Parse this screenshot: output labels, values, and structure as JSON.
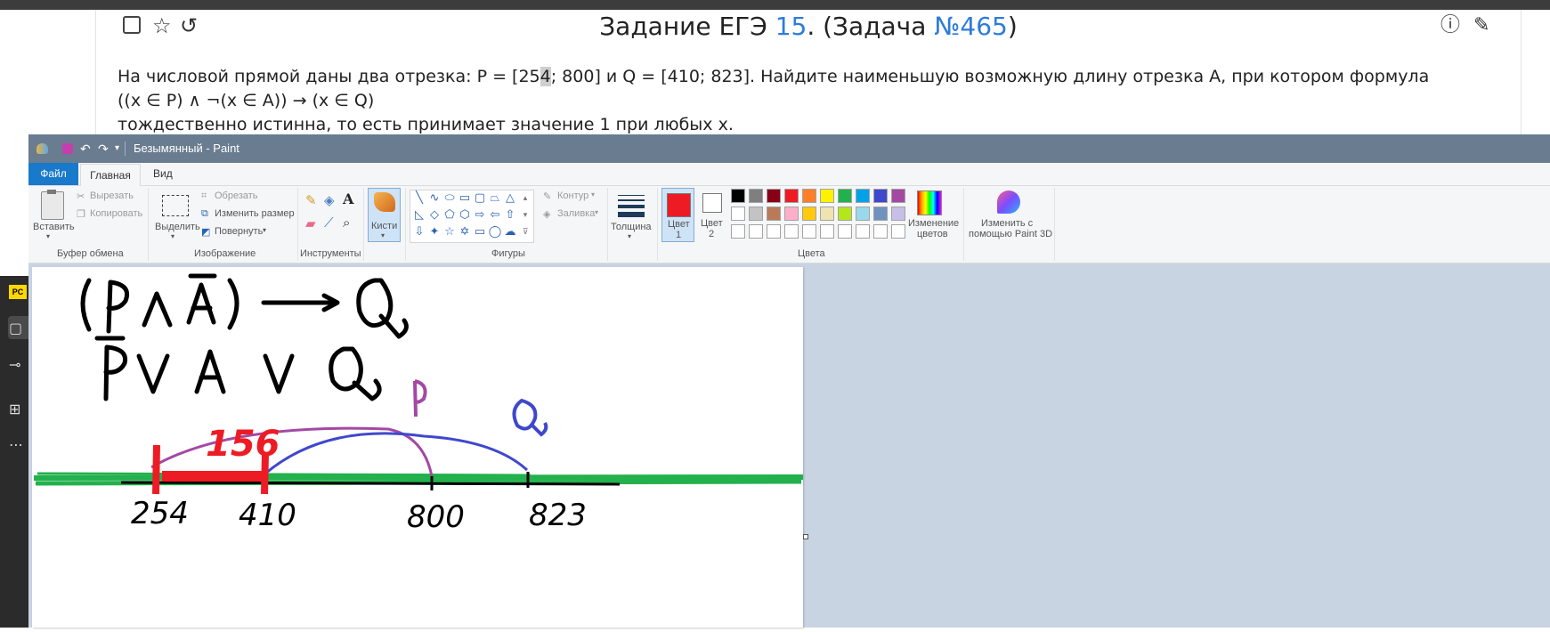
{
  "webpage": {
    "title_prefix": "Задание ЕГЭ ",
    "task_number": "15",
    "title_mid": ". (Задача ",
    "problem_number": "№465",
    "title_suffix": ")",
    "text_line1_a": "На числовой прямой даны два отрезка: P = [25",
    "text_line1_hl": "4",
    "text_line1_b": "; 800] и Q = [410; 823]. Найдите наименьшую возможную длину отрезка A, при котором формула",
    "text_line2": "((x ∈ P) ∧ ¬(x ∈ A)) → (x ∈ Q)",
    "text_line3": "тождественно истинна, то есть принимает значение 1 при любых x.",
    "icons": [
      "checkbox-icon",
      "star-icon",
      "history-icon",
      "report-icon",
      "edit-icon"
    ]
  },
  "side_panel": {
    "badge": "PC"
  },
  "paint": {
    "window_title": "Безымянный - Paint",
    "tabs": {
      "file": "Файл",
      "home": "Главная",
      "view": "Вид"
    },
    "clipboard": {
      "paste": "Вставить",
      "cut": "Вырезать",
      "copy": "Копировать",
      "group": "Буфер обмена"
    },
    "image": {
      "select": "Выделить",
      "crop": "Обрезать",
      "resize": "Изменить размер",
      "rotate": "Повернуть",
      "group": "Изображение"
    },
    "tools": {
      "group": "Инструменты"
    },
    "brushes": {
      "label": "Кисти"
    },
    "shapes": {
      "outline": "Контур",
      "fill": "Заливка",
      "group": "Фигуры"
    },
    "size": {
      "label": "Толщина"
    },
    "colors": {
      "color1": "Цвет",
      "color1_num": "1",
      "color2": "Цвет",
      "color2_num": "2",
      "edit_colors_1": "Изменение",
      "edit_colors_2": "цветов",
      "paint3d_1": "Изменить с",
      "paint3d_2": "помощью Paint 3D",
      "group": "Цвета",
      "color1_value": "#ed1c24",
      "palette_row1": [
        "#000000",
        "#7f7f7f",
        "#880015",
        "#ed1c24",
        "#ff7f27",
        "#fff200",
        "#22b14c",
        "#00a2e8",
        "#3f48cc",
        "#a349a4"
      ],
      "palette_row2": [
        "#ffffff",
        "#c3c3c3",
        "#b97a57",
        "#ffaec9",
        "#ffc90e",
        "#efe4b0",
        "#b5e61d",
        "#99d9ea",
        "#7092be",
        "#c8bfe7"
      ]
    }
  },
  "drawing": {
    "number_labels": [
      "254",
      "410",
      "800",
      "823"
    ],
    "length_label": "156",
    "set_labels": [
      "P",
      "Q"
    ],
    "formula_line1": "(P ∧ Ā) ⟶ Q",
    "formula_line2": "P̄ ∨ A ∨ Q",
    "ink": {
      "black": "#000000",
      "green": "#22b14c",
      "red": "#ed1c24",
      "purple": "#a349a4",
      "blue": "#3f48cc"
    }
  }
}
